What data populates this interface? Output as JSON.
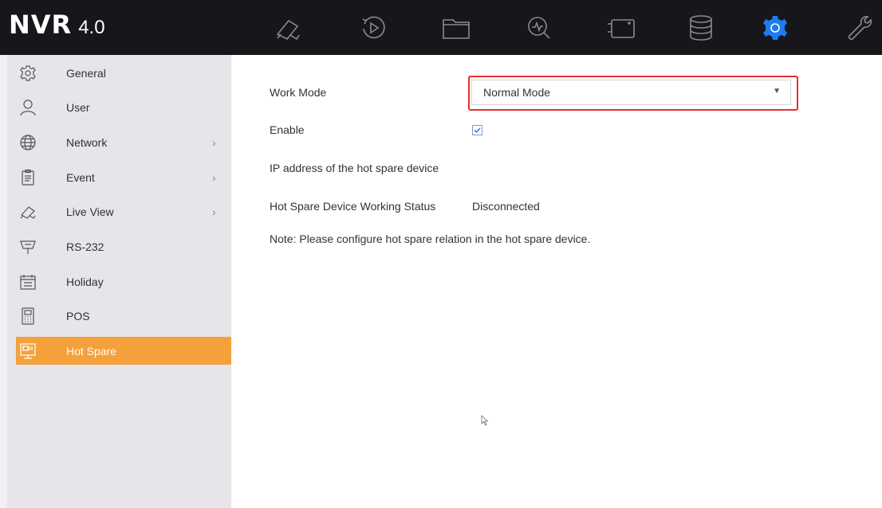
{
  "app": {
    "logo_main": "NVR",
    "logo_version": "4.0"
  },
  "toolbar": {
    "icons": [
      "live-view-icon",
      "playback-icon",
      "file-management-icon",
      "smart-analysis-icon",
      "camera-icon",
      "storage-icon",
      "system-settings-icon",
      "maintenance-icon"
    ],
    "active_color": "#1e7bf2"
  },
  "sidebar": {
    "items": [
      {
        "label": "General",
        "icon": "gear-icon",
        "chevron": ""
      },
      {
        "label": "User",
        "icon": "user-icon",
        "chevron": ""
      },
      {
        "label": "Network",
        "icon": "globe-icon",
        "chevron": "›"
      },
      {
        "label": "Event",
        "icon": "clipboard-icon",
        "chevron": "›"
      },
      {
        "label": "Live View",
        "icon": "camera-icon",
        "chevron": "›"
      },
      {
        "label": "RS-232",
        "icon": "serial-port-icon",
        "chevron": ""
      },
      {
        "label": "Holiday",
        "icon": "calendar-icon",
        "chevron": ""
      },
      {
        "label": "POS",
        "icon": "pos-terminal-icon",
        "chevron": ""
      },
      {
        "label": "Hot Spare",
        "icon": "hot-spare-icon",
        "chevron": ""
      }
    ],
    "active_item": "Hot Spare",
    "active_color": "#f4a03b"
  },
  "main": {
    "work_mode_label": "Work Mode",
    "work_mode_value": "Normal Mode",
    "enable_label": "Enable",
    "enable_checked": true,
    "ip_label": "IP address of the hot spare device",
    "status_label": "Hot Spare Device Working Status",
    "status_value": "Disconnected",
    "note": "Note: Please configure hot spare relation in the hot spare device."
  }
}
